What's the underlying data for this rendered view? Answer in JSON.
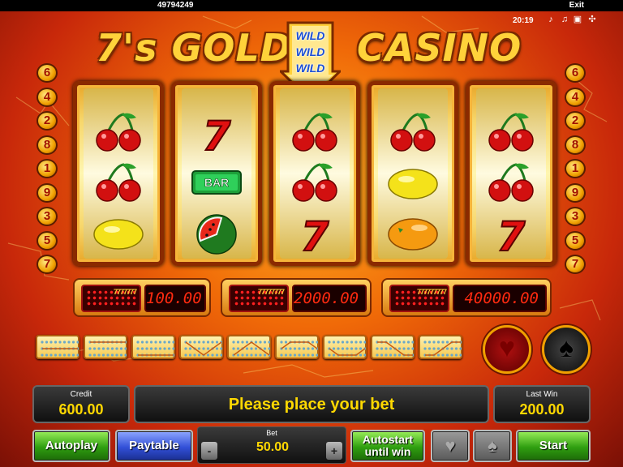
{
  "top": {
    "game_id": "49794249",
    "exit_label": "Exit",
    "time": "20:19"
  },
  "logo": {
    "left_text": "7's GOLD",
    "right_text": "CASINO",
    "wild_words": [
      "WILD",
      "WILD",
      "WILD"
    ]
  },
  "line_numbers": {
    "left": [
      "6",
      "4",
      "2",
      "8",
      "1",
      "9",
      "3",
      "5",
      "7"
    ],
    "right": [
      "6",
      "4",
      "2",
      "8",
      "1",
      "9",
      "3",
      "5",
      "7"
    ]
  },
  "reels": [
    [
      "cherry",
      "cherry",
      "lemon"
    ],
    [
      "seven",
      "bar",
      "watermelon"
    ],
    [
      "cherry",
      "cherry",
      "seven"
    ],
    [
      "cherry",
      "lemon",
      "orange"
    ],
    [
      "cherry",
      "cherry",
      "seven"
    ]
  ],
  "symbol_text": {
    "bar": "BAR",
    "seven": "7"
  },
  "jackpots": [
    {
      "sevens": "7777777",
      "value": "100.00"
    },
    {
      "sevens": "77777777",
      "value": "2000.00"
    },
    {
      "sevens": "777777777",
      "value": "40000.00"
    }
  ],
  "info": {
    "credit_label": "Credit",
    "credit_value": "600.00",
    "message": "Please place your bet",
    "last_win_label": "Last Win",
    "last_win_value": "200.00"
  },
  "controls": {
    "autoplay": "Autoplay",
    "paytable": "Paytable",
    "bet_label": "Bet",
    "bet_value": "50.00",
    "minus": "-",
    "plus": "+",
    "autostart_line1": "Autostart",
    "autostart_line2": "until win",
    "start": "Start"
  },
  "icons": [
    "music-icon",
    "sound-icon",
    "fullscreen-icon",
    "settings-icon",
    "heart-icon",
    "spade-icon"
  ],
  "colors": {
    "brand_gold": "#ffd23a",
    "jackpot_digits": "#ff2a10",
    "value_yellow": "#ffd800"
  }
}
